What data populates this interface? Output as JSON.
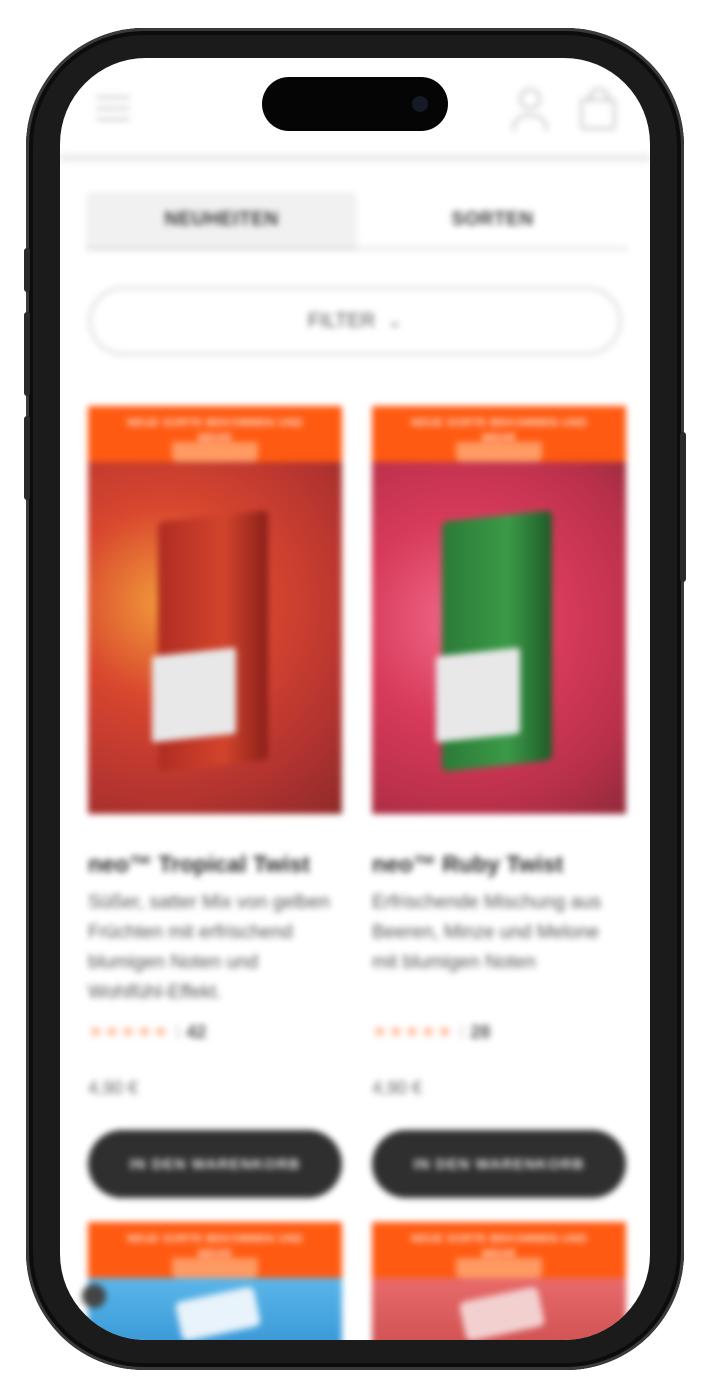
{
  "header": {
    "menu_icon": "hamburger-menu-icon",
    "account_icon": "user-icon",
    "cart_icon": "shopping-bag-icon"
  },
  "tabs": [
    {
      "label": "NEUHEITEN",
      "active": true
    },
    {
      "label": "SORTEN",
      "active": false
    }
  ],
  "filter": {
    "label": "FILTER",
    "icon": "chevron-down-icon"
  },
  "products": [
    {
      "promo": "NEUE SORTE BEKOMMEN UND MEHR",
      "title": "neo™ Tropical Twist",
      "description": "Süßer, satter Mix von gelben Früchten mit erfrischend blumigen Noten und Wohlfühl-Effekt.",
      "stars": "★★★★★",
      "rating_count": "42",
      "price": "4,90 €",
      "cta": "IN DEN WARENKORB",
      "accent": "#b8372f"
    },
    {
      "promo": "NEUE SORTE BEKOMMEN UND MEHR",
      "title": "neo™ Ruby Twist",
      "description": "Erfrischende Mischung aus Beeren, Minze und Melone mit blumigen Noten",
      "stars": "★★★★★",
      "rating_count": "28",
      "price": "4,90 €",
      "cta": "IN DEN WARENKORB",
      "accent": "#2f7a3c"
    },
    {
      "promo": "NEUE SORTE BEKOMMEN UND MEHR",
      "accent": "#4aa7e0"
    },
    {
      "promo": "NEUE SORTE BEKOMMEN UND MEHR",
      "accent": "#d94b4b"
    }
  ],
  "colors": {
    "promo_orange": "#ff5a12",
    "cta_dark": "#2f2f2f",
    "star_orange": "#ffb08a"
  }
}
